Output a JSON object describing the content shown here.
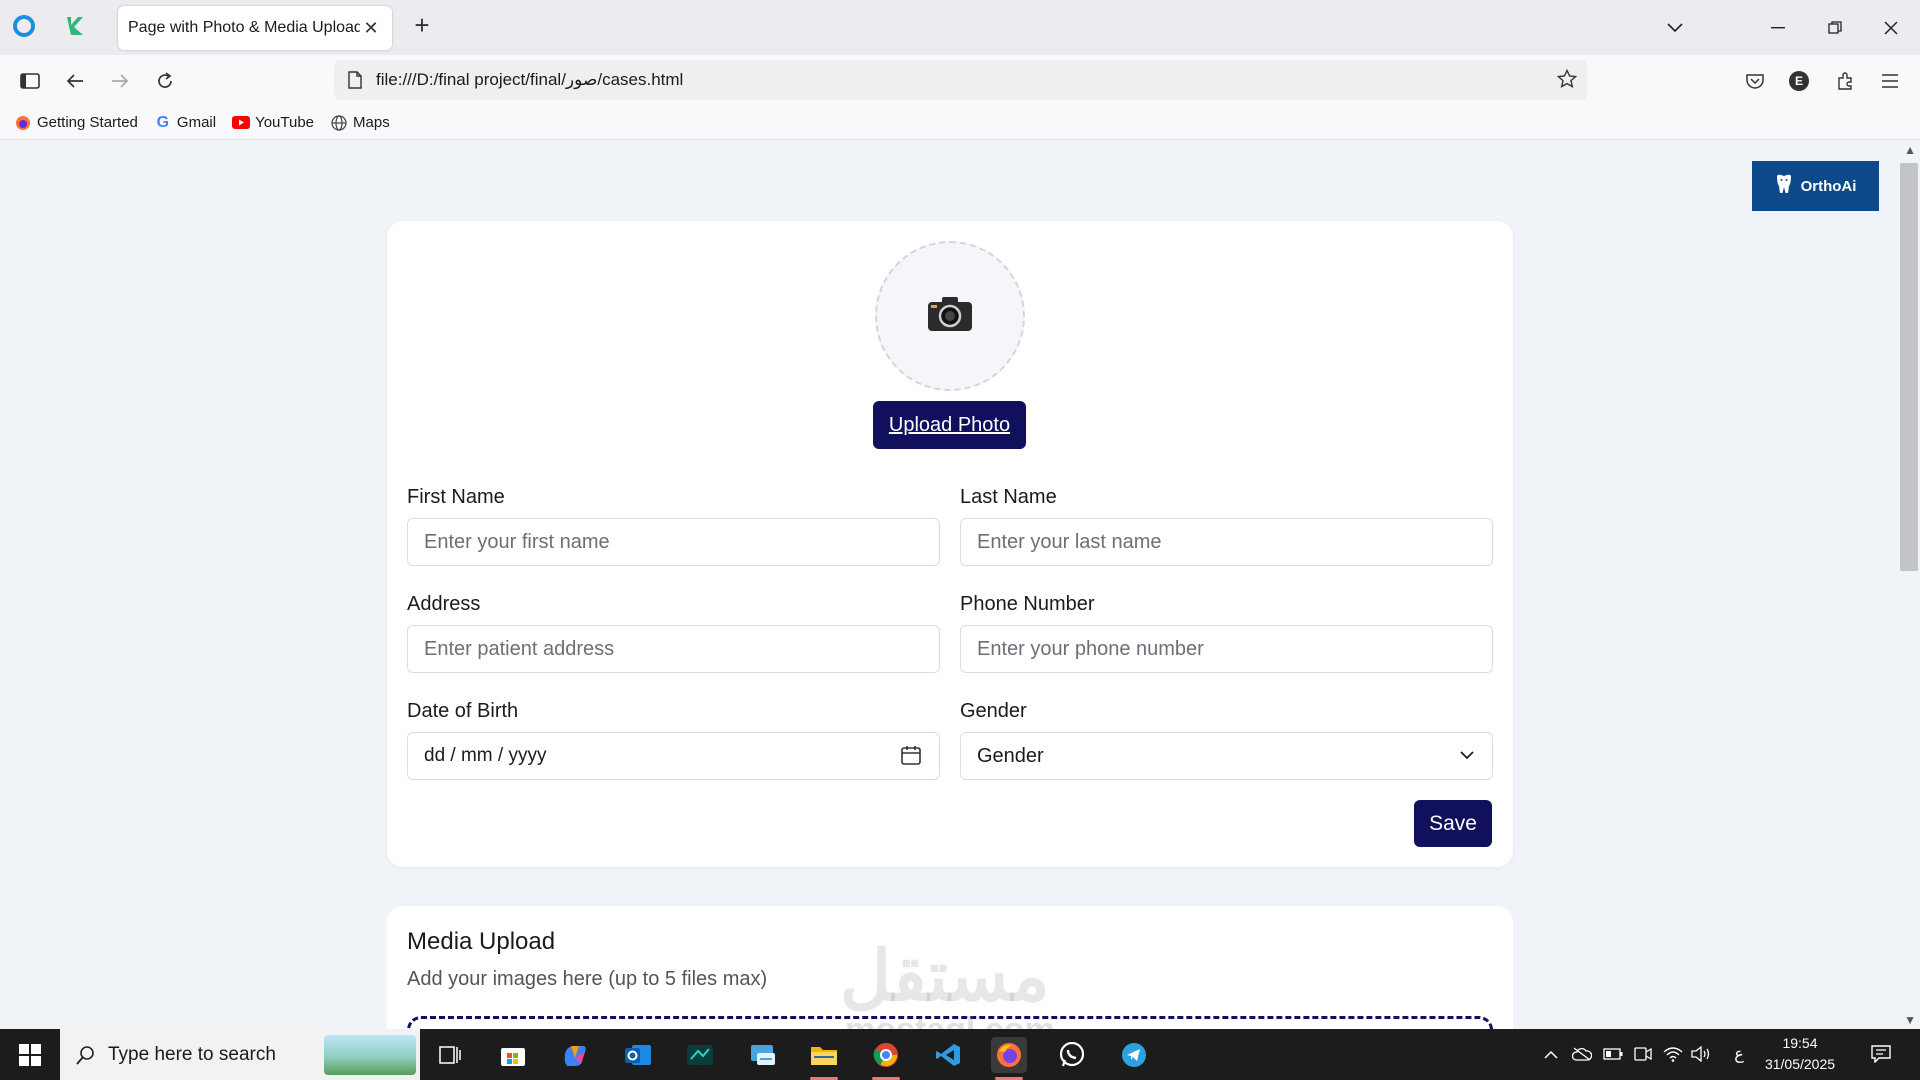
{
  "browser": {
    "tab_title": "Page with Photo & Media Upload",
    "url": "file:///D:/final project/final/صور/cases.html",
    "bookmarks": [
      {
        "label": "Getting Started",
        "icon": "firefox-icon"
      },
      {
        "label": "Gmail",
        "icon": "google-icon"
      },
      {
        "label": "YouTube",
        "icon": "youtube-icon"
      },
      {
        "label": "Maps",
        "icon": "globe-icon"
      }
    ],
    "profile_initial": "E"
  },
  "page": {
    "brand": "OrthoAi",
    "photo": {
      "icon": "camera-icon",
      "upload_label": "Upload Photo"
    },
    "form": {
      "first_name": {
        "label": "First Name",
        "placeholder": "Enter your first name"
      },
      "last_name": {
        "label": "Last Name",
        "placeholder": "Enter your last name"
      },
      "address": {
        "label": "Address",
        "placeholder": "Enter patient address"
      },
      "phone": {
        "label": "Phone Number",
        "placeholder": "Enter your phone number"
      },
      "dob": {
        "label": "Date of Birth",
        "value": "dd / mm / yyyy"
      },
      "gender": {
        "label": "Gender",
        "selected": "Gender"
      },
      "save_label": "Save"
    },
    "media": {
      "title": "Media Upload",
      "subtitle": "Add your images here (up to 5 files max)"
    },
    "watermark": {
      "line1": "مستقل",
      "line2": "mostaql.com"
    }
  },
  "taskbar": {
    "search_placeholder": "Type here to search",
    "apps": [
      "task-view-icon",
      "store-icon",
      "copilot-icon",
      "outlook-icon",
      "app-icon",
      "control-panel-icon",
      "file-explorer-icon",
      "chrome-icon",
      "vscode-icon",
      "firefox-icon",
      "whatsapp-icon",
      "telegram-icon"
    ],
    "language": "ع",
    "time": "19:54",
    "date": "31/05/2025"
  },
  "colors": {
    "primary": "#10105c",
    "brand_badge": "#0d4a8c",
    "page_bg": "#f0f3f7"
  }
}
